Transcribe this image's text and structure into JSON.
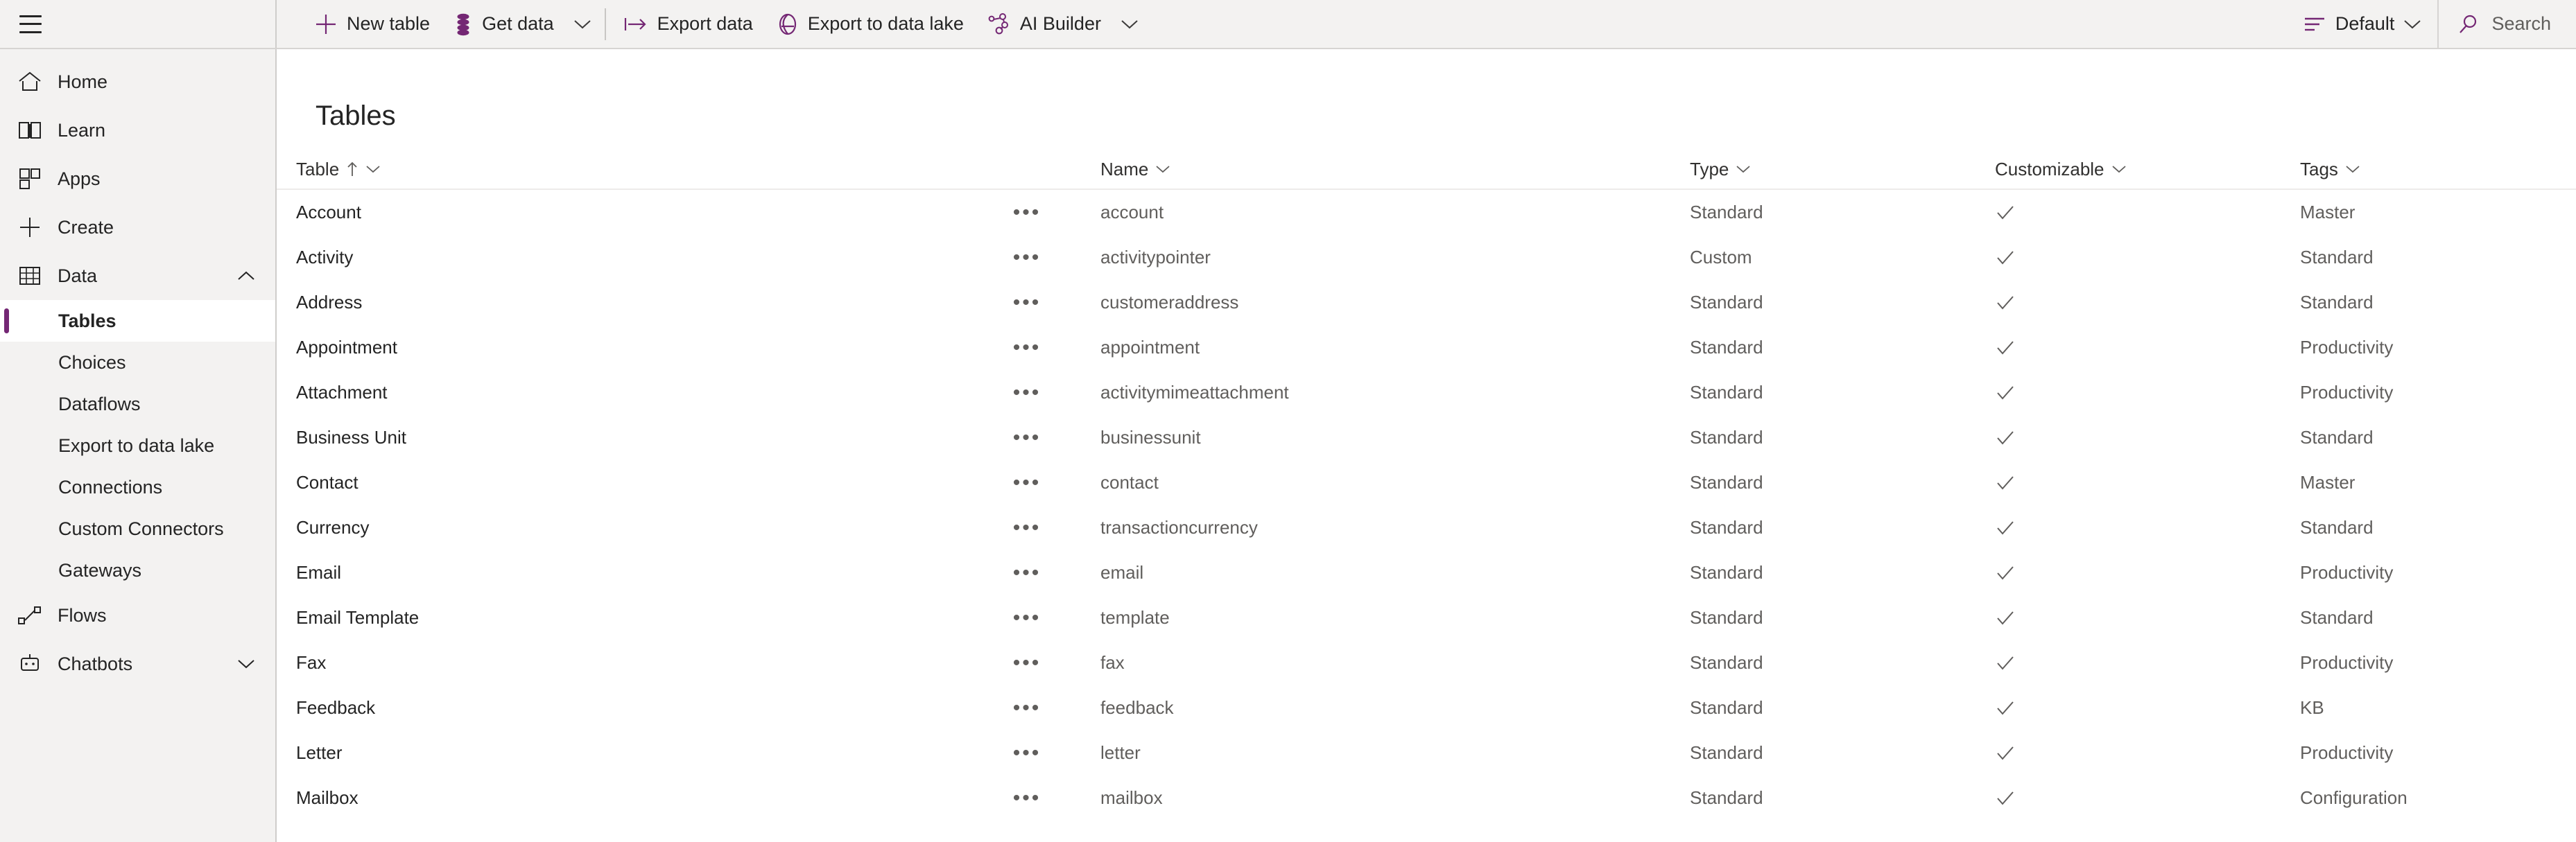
{
  "topbar": {
    "menu_icon": "hamburger-menu-icon",
    "commands": [
      {
        "id": "new-table",
        "label": "New table",
        "icon": "plus-icon"
      },
      {
        "id": "get-data",
        "label": "Get data",
        "icon": "database-stack-icon"
      },
      {
        "id": "get-data-chevron",
        "label": "",
        "icon": "chevron-down-icon"
      },
      {
        "id": "export-data",
        "label": "Export data",
        "icon": "export-arrow-icon"
      },
      {
        "id": "export-data-lake",
        "label": "Export to data lake",
        "icon": "data-lake-icon"
      },
      {
        "id": "ai-builder",
        "label": "AI Builder",
        "icon": "ai-builder-icon"
      },
      {
        "id": "ai-builder-chevron",
        "label": "",
        "icon": "chevron-down-icon"
      }
    ],
    "view_selector": {
      "label": "Default",
      "icon": "view-list-icon",
      "chevron": "chevron-down-icon"
    },
    "search": {
      "label": "Search",
      "placeholder": "Search",
      "icon": "search-icon"
    }
  },
  "sidebar": {
    "items": [
      {
        "label": "Home",
        "icon": "home-icon",
        "type": "top"
      },
      {
        "label": "Learn",
        "icon": "book-icon",
        "type": "top"
      },
      {
        "label": "Apps",
        "icon": "apps-grid-icon",
        "type": "top"
      },
      {
        "label": "Create",
        "icon": "plus-icon",
        "type": "top"
      },
      {
        "label": "Data",
        "icon": "table-grid-icon",
        "type": "top",
        "expanded": true,
        "chevron": "chevron-up-icon"
      }
    ],
    "data_children": [
      {
        "label": "Tables",
        "selected": true
      },
      {
        "label": "Choices",
        "selected": false
      },
      {
        "label": "Dataflows",
        "selected": false
      },
      {
        "label": "Export to data lake",
        "selected": false
      },
      {
        "label": "Connections",
        "selected": false
      },
      {
        "label": "Custom Connectors",
        "selected": false
      },
      {
        "label": "Gateways",
        "selected": false
      }
    ],
    "items_after": [
      {
        "label": "Flows",
        "icon": "flow-icon",
        "type": "top"
      },
      {
        "label": "Chatbots",
        "icon": "robot-icon",
        "type": "top",
        "chevron": "chevron-down-icon"
      }
    ]
  },
  "main": {
    "page_title": "Tables",
    "columns": [
      {
        "key": "table",
        "label": "Table",
        "sorted": true,
        "sort_icon": "sort-asc-arrow-icon",
        "chevron": "chevron-down-icon"
      },
      {
        "key": "name",
        "label": "Name",
        "sorted": false,
        "chevron": "chevron-down-icon"
      },
      {
        "key": "type",
        "label": "Type",
        "sorted": false,
        "chevron": "chevron-down-icon"
      },
      {
        "key": "customizable",
        "label": "Customizable",
        "sorted": false,
        "chevron": "chevron-down-icon"
      },
      {
        "key": "tags",
        "label": "Tags",
        "sorted": false,
        "chevron": "chevron-down-icon"
      }
    ],
    "row_overflow_label": "•••",
    "check_glyph": "✓",
    "rows": [
      {
        "table": "Account",
        "name": "account",
        "type": "Standard",
        "customizable": true,
        "tags": "Master"
      },
      {
        "table": "Activity",
        "name": "activitypointer",
        "type": "Custom",
        "customizable": true,
        "tags": "Standard"
      },
      {
        "table": "Address",
        "name": "customeraddress",
        "type": "Standard",
        "customizable": true,
        "tags": "Standard"
      },
      {
        "table": "Appointment",
        "name": "appointment",
        "type": "Standard",
        "customizable": true,
        "tags": "Productivity"
      },
      {
        "table": "Attachment",
        "name": "activitymimeattachment",
        "type": "Standard",
        "customizable": true,
        "tags": "Productivity"
      },
      {
        "table": "Business Unit",
        "name": "businessunit",
        "type": "Standard",
        "customizable": true,
        "tags": "Standard"
      },
      {
        "table": "Contact",
        "name": "contact",
        "type": "Standard",
        "customizable": true,
        "tags": "Master"
      },
      {
        "table": "Currency",
        "name": "transactioncurrency",
        "type": "Standard",
        "customizable": true,
        "tags": "Standard"
      },
      {
        "table": "Email",
        "name": "email",
        "type": "Standard",
        "customizable": true,
        "tags": "Productivity"
      },
      {
        "table": "Email Template",
        "name": "template",
        "type": "Standard",
        "customizable": true,
        "tags": "Standard"
      },
      {
        "table": "Fax",
        "name": "fax",
        "type": "Standard",
        "customizable": true,
        "tags": "Productivity"
      },
      {
        "table": "Feedback",
        "name": "feedback",
        "type": "Standard",
        "customizable": true,
        "tags": "KB"
      },
      {
        "table": "Letter",
        "name": "letter",
        "type": "Standard",
        "customizable": true,
        "tags": "Productivity"
      },
      {
        "table": "Mailbox",
        "name": "mailbox",
        "type": "Standard",
        "customizable": true,
        "tags": "Configuration"
      }
    ]
  },
  "colors": {
    "accent_purple": "#742774",
    "chrome_gray": "#f3f2f1",
    "text_primary": "#242424",
    "text_secondary": "#605e5c"
  }
}
